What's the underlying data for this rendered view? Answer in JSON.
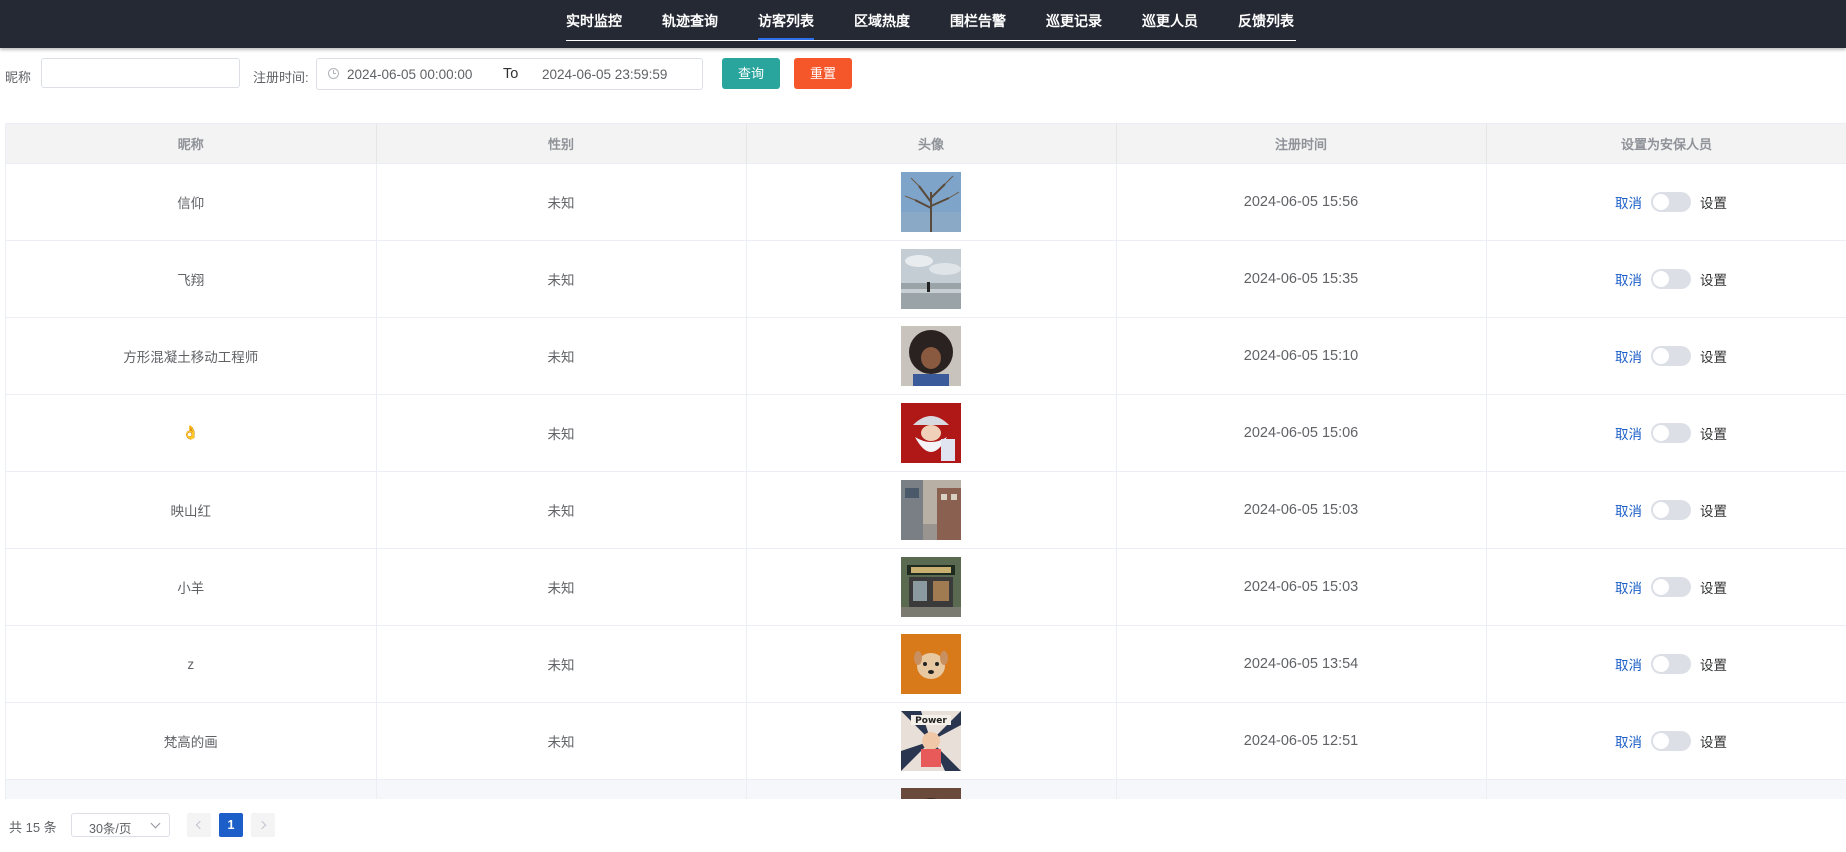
{
  "nav": {
    "items": [
      "实时监控",
      "轨迹查询",
      "访客列表",
      "区域热度",
      "围栏告警",
      "巡更记录",
      "巡更人员",
      "反馈列表"
    ],
    "active": "访客列表"
  },
  "filter": {
    "nickname_label": "昵称",
    "nickname_value": "",
    "time_label": "注册时间:",
    "start": "2024-06-05 00:00:00",
    "separator": "To",
    "end": "2024-06-05 23:59:59",
    "query_label": "查询",
    "reset_label": "重置",
    "query_color": "#2aa59d",
    "reset_color": "#f5562a"
  },
  "table": {
    "headers": [
      "昵称",
      "性别",
      "头像",
      "注册时间",
      "设置为安保人员"
    ],
    "rows": [
      {
        "nickname": "信仰",
        "gender": "未知",
        "avatar": "tree-photo",
        "time": "2024-06-05 15:56",
        "cancel": "取消",
        "set": "设置",
        "switch_on": false
      },
      {
        "nickname": "飞翔",
        "gender": "未知",
        "avatar": "beach-sky-photo",
        "time": "2024-06-05 15:35",
        "cancel": "取消",
        "set": "设置",
        "switch_on": false
      },
      {
        "nickname": "方形混凝土移动工程师",
        "gender": "未知",
        "avatar": "curly-hair-photo",
        "time": "2024-06-05 15:10",
        "cancel": "取消",
        "set": "设置",
        "switch_on": false
      },
      {
        "nickname": "👌",
        "gender": "未知",
        "avatar": "santa-cartoon",
        "time": "2024-06-05 15:06",
        "cancel": "取消",
        "set": "设置",
        "switch_on": false
      },
      {
        "nickname": "映山红",
        "gender": "未知",
        "avatar": "street-photo",
        "time": "2024-06-05 15:03",
        "cancel": "取消",
        "set": "设置",
        "switch_on": false
      },
      {
        "nickname": "小羊",
        "gender": "未知",
        "avatar": "shopfront-photo",
        "time": "2024-06-05 15:03",
        "cancel": "取消",
        "set": "设置",
        "switch_on": false
      },
      {
        "nickname": "z",
        "gender": "未知",
        "avatar": "dog-photo",
        "time": "2024-06-05 13:54",
        "cancel": "取消",
        "set": "设置",
        "switch_on": false
      },
      {
        "nickname": "梵高的画",
        "gender": "未知",
        "avatar": "power-cartoon",
        "time": "2024-06-05 12:51",
        "cancel": "取消",
        "set": "设置",
        "switch_on": false
      }
    ]
  },
  "pagination": {
    "total": "共 15 条",
    "page_size": "30条/页",
    "current_page": "1"
  },
  "colors": {
    "nav_bg": "#252934",
    "accent": "#1c5fc8",
    "link": "#1c5fc8"
  }
}
